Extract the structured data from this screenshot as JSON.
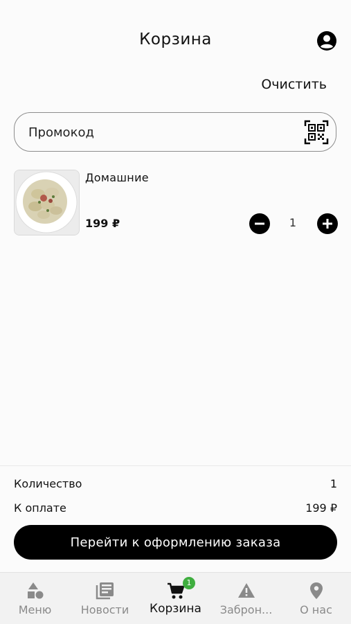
{
  "header": {
    "title": "Корзина",
    "clear_label": "Очистить"
  },
  "promo": {
    "placeholder": "Промокод"
  },
  "cart": {
    "items": [
      {
        "name": "Домашние",
        "price": "199 ₽",
        "quantity": "1"
      }
    ]
  },
  "summary": {
    "quantity_label": "Количество",
    "quantity_value": "1",
    "total_label": "К оплате",
    "total_value": "199 ₽",
    "checkout_label": "Перейти к оформлению заказа"
  },
  "nav": {
    "items": [
      {
        "label": "Меню",
        "icon": "shapes-icon"
      },
      {
        "label": "Новости",
        "icon": "news-icon"
      },
      {
        "label": "Корзина",
        "icon": "cart-icon",
        "badge": "1"
      },
      {
        "label": "Заброн...",
        "icon": "warning-icon"
      },
      {
        "label": "О нас",
        "icon": "location-pin-icon"
      }
    ]
  },
  "colors": {
    "accent": "#000000",
    "badge": "#3fae3f",
    "inactive": "#8a8a8a"
  }
}
